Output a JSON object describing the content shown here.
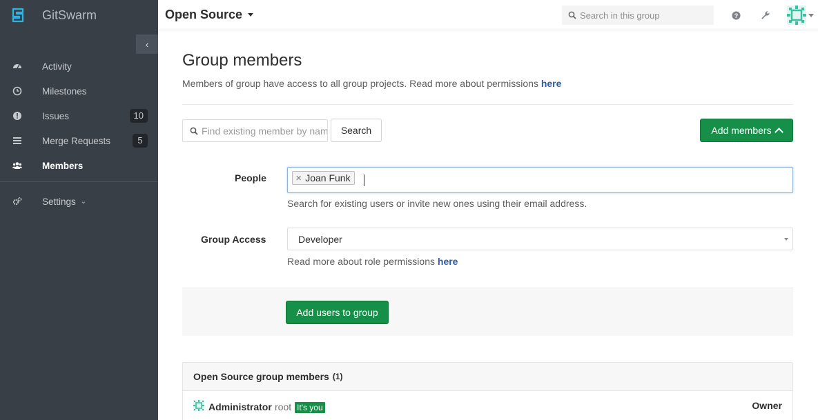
{
  "sidebar": {
    "brand": "GitSwarm",
    "collapse_icon": "chevron-left-icon",
    "items": [
      {
        "label": "Activity",
        "icon": "dashboard-icon",
        "badge": ""
      },
      {
        "label": "Milestones",
        "icon": "clock-icon",
        "badge": ""
      },
      {
        "label": "Issues",
        "icon": "exclamation-circle-icon",
        "badge": "10"
      },
      {
        "label": "Merge Requests",
        "icon": "list-icon",
        "badge": "5"
      },
      {
        "label": "Members",
        "icon": "users-icon",
        "badge": "",
        "active": true
      }
    ],
    "settings_label": "Settings"
  },
  "header": {
    "group_title": "Open Source",
    "search_placeholder": "Search in this group"
  },
  "main": {
    "title": "Group members",
    "description": "Members of group have access to all group projects. Read more about permissions ",
    "description_link": "here",
    "find_placeholder": "Find existing member by name",
    "search_button": "Search",
    "add_members_button": "Add members",
    "form": {
      "people_label": "People",
      "people_tokens": [
        "Joan Funk"
      ],
      "people_help": "Search for existing users or invite new ones using their email address.",
      "access_label": "Group Access",
      "access_value": "Developer",
      "access_help": "Read more about role permissions ",
      "access_help_link": "here",
      "submit_button": "Add users to group"
    },
    "members_panel": {
      "title": "Open Source group members",
      "count": "(1)",
      "members": [
        {
          "name": "Administrator",
          "username": "root",
          "badge": "It's you",
          "role": "Owner"
        }
      ]
    }
  },
  "colors": {
    "sidebar_bg": "#393f47",
    "accent_green": "#168f48",
    "link_blue": "#2e5ca8"
  }
}
